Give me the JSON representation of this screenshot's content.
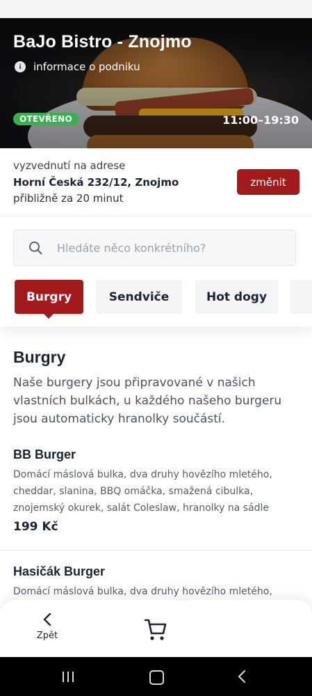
{
  "restaurant": {
    "name": "BaJo Bistro - Znojmo",
    "info_link": "informace o podniku",
    "status": "OTEVŘENO",
    "hours": "11:00–19:30"
  },
  "pickup": {
    "label": "vyzvednutí na adrese",
    "address": "Horní Česká 232/12, Znojmo",
    "eta": "přibližně za 20 minut",
    "change_button": "změnit"
  },
  "search": {
    "placeholder": "Hledáte něco konkrétního?",
    "value": ""
  },
  "tabs": [
    {
      "label": "Burgry",
      "active": true
    },
    {
      "label": "Sendviče",
      "active": false
    },
    {
      "label": "Hot dogy",
      "active": false
    }
  ],
  "category": {
    "title": "Burgry",
    "description": "Naše burgery jsou připravované v našich vlastních bulkách, u každého našeho burgeru jsou automaticky hranolky součástí."
  },
  "items": [
    {
      "name": "BB Burger",
      "description": "Domácí máslová bulka, dva druhy hovězího mletého, cheddar, slanina, BBQ omáčka, smažená cibulka, znojemský okurek, salát Coleslaw, hranolky na sádle",
      "price": "199 Kč"
    },
    {
      "name": "Hasičák Burger",
      "description": "Domácí máslová bulka, dva druhy hovězího mletého,"
    }
  ],
  "bottom_nav": {
    "back_label": "Zpět",
    "cart_icon": "cart-icon"
  },
  "colors": {
    "accent": "#a31a1c",
    "open_badge": "#36b24a",
    "text": "#1c2433"
  }
}
